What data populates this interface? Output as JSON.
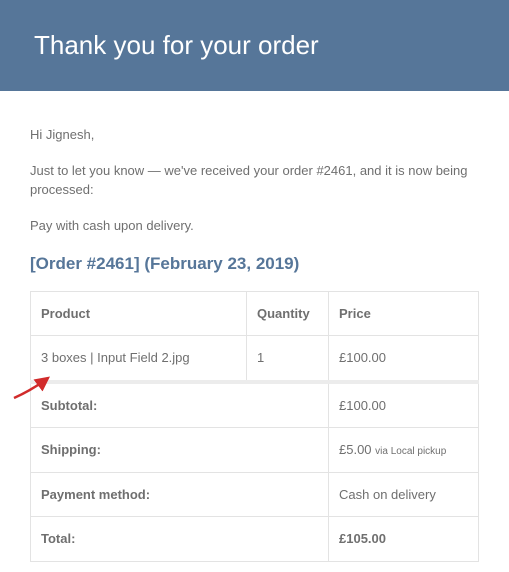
{
  "header": {
    "title": "Thank you for your order"
  },
  "body": {
    "greeting": "Hi Jignesh,",
    "intro": "Just to let you know — we've received your order #2461, and it is now being processed:",
    "payNote": "Pay with cash upon delivery.",
    "orderHeading": "[Order #2461] (February 23, 2019)"
  },
  "table": {
    "headers": {
      "product": "Product",
      "quantity": "Quantity",
      "price": "Price"
    },
    "row": {
      "product": "3 boxes | Input Field 2.jpg",
      "quantity": "1",
      "price": "£100.00"
    },
    "subtotalLabel": "Subtotal:",
    "subtotalValue": "£100.00",
    "shippingLabel": "Shipping:",
    "shippingValue": "£5.00 ",
    "shippingVia": "via Local pickup",
    "paymentLabel": "Payment method:",
    "paymentValue": "Cash on delivery",
    "totalLabel": "Total:",
    "totalValue": "£105.00"
  }
}
